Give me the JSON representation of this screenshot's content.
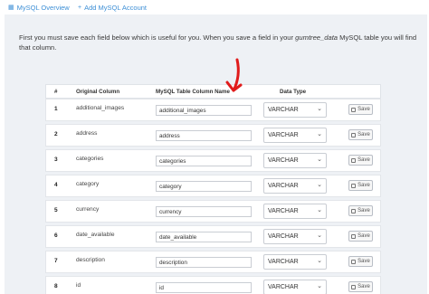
{
  "nav": {
    "overview_label": "MySQL Overview",
    "add_label": "Add MySQL Account"
  },
  "intro": {
    "part1": "First you must save each field below which is useful for you. When you save a field in your ",
    "table_name": "gumtree_data",
    "part2": " MySQL table you will find that column."
  },
  "table": {
    "headers": {
      "num": "#",
      "original": "Original Column",
      "mysql": "MySQL Table Column Name",
      "type": "Data Type"
    },
    "rows": [
      {
        "num": "1",
        "original": "additional_images",
        "value": "additional_images",
        "type": "VARCHAR"
      },
      {
        "num": "2",
        "original": "address",
        "value": "address",
        "type": "VARCHAR"
      },
      {
        "num": "3",
        "original": "categories",
        "value": "categories",
        "type": "VARCHAR"
      },
      {
        "num": "4",
        "original": "category",
        "value": "category",
        "type": "VARCHAR"
      },
      {
        "num": "5",
        "original": "currency",
        "value": "currency",
        "type": "VARCHAR"
      },
      {
        "num": "6",
        "original": "date_available",
        "value": "date_available",
        "type": "VARCHAR"
      },
      {
        "num": "7",
        "original": "description",
        "value": "description",
        "type": "VARCHAR"
      },
      {
        "num": "8",
        "original": "id",
        "value": "id",
        "type": "VARCHAR"
      }
    ],
    "save_label": "Save"
  },
  "colors": {
    "link": "#3d8fd6",
    "annotation_arrow": "#e01b1b"
  }
}
